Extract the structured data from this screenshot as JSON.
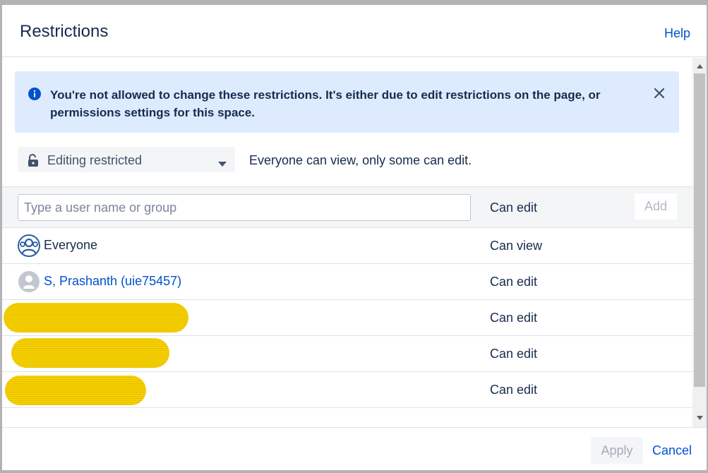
{
  "dialog": {
    "title": "Restrictions",
    "help_label": "Help"
  },
  "banner": {
    "icon": "info-icon",
    "message": "You're not allowed to change these restrictions. It's either due to edit restrictions on the page, or permissions settings for this space.",
    "close_icon": "close-icon"
  },
  "restriction_mode": {
    "icon": "unlock-icon",
    "selected": "Editing restricted",
    "description": "Everyone can view, only some can edit."
  },
  "add_user": {
    "placeholder": "Type a user name or group",
    "permission": "Can edit",
    "add_label": "Add"
  },
  "entries": [
    {
      "name": "Everyone",
      "permission": "Can view",
      "avatar": "group-icon",
      "redacted": false
    },
    {
      "name": "S, Prashanth (uie75457)",
      "permission": "Can edit",
      "avatar": "user-icon",
      "redacted": false
    },
    {
      "name": "",
      "permission": "Can edit",
      "redacted": true
    },
    {
      "name": "",
      "permission": "Can edit",
      "redacted": true
    },
    {
      "name": "",
      "permission": "Can edit",
      "redacted": true
    }
  ],
  "footer": {
    "apply_label": "Apply",
    "cancel_label": "Cancel"
  },
  "colors": {
    "accent": "#0052cc",
    "banner_bg": "#deebff",
    "redaction": "#f5cf00"
  }
}
